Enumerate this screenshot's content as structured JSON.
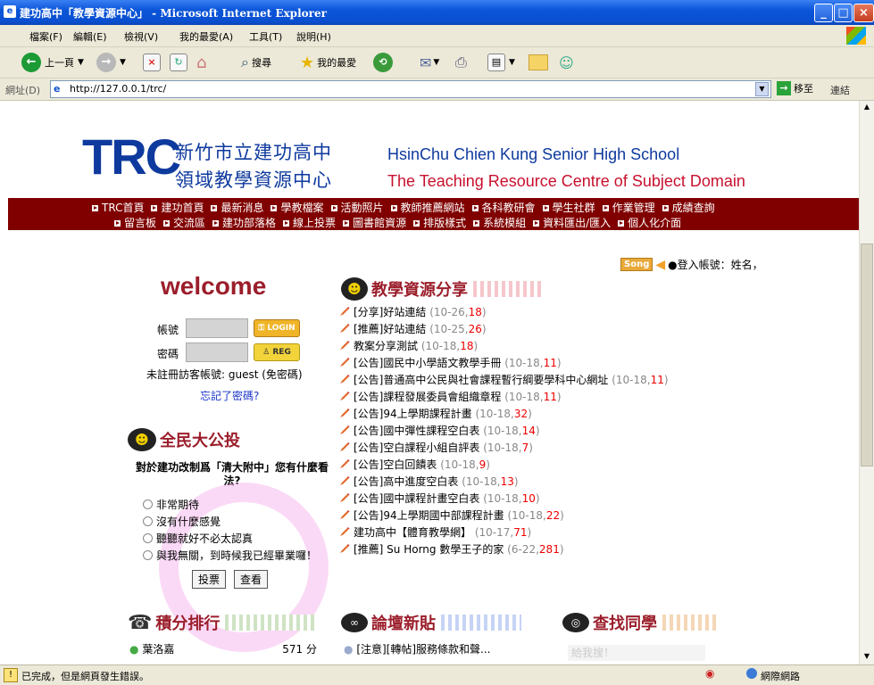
{
  "window": {
    "title": "建功高中「教學資源中心」 - Microsoft Internet Explorer"
  },
  "menubar": [
    "檔案(F)",
    "編輯(E)",
    "檢視(V)",
    "我的最愛(A)",
    "工具(T)",
    "說明(H)"
  ],
  "toolbar": {
    "back": "上一頁",
    "search": "搜尋",
    "favorites": "我的最愛"
  },
  "address": {
    "label": "網址(D)",
    "url": "http://127.0.0.1/trc/",
    "go": "移至",
    "links": "連結"
  },
  "header": {
    "logo": "TRC",
    "zh_line1": "新竹市立建功高中",
    "zh_line2": "領域教學資源中心",
    "en_line1": "HsinChu Chien Kung Senior High School",
    "en_line2": "The Teaching Resource Centre of Subject Domain"
  },
  "nav": {
    "row1": [
      "TRC首頁",
      "建功首頁",
      "最新消息",
      "學教檔案",
      "活動照片",
      "教師推薦網站",
      "各科教研會",
      "學生社群",
      "作業管理",
      "成績查詢"
    ],
    "row2": [
      "留言板",
      "交流區",
      "建功部落格",
      "線上投票",
      "圖書館資源",
      "排版樣式",
      "系統模組",
      "資料匯出/匯入",
      "個人化介面"
    ]
  },
  "userbar": {
    "song": "Song",
    "login_info": "●登入帳號：姓名，"
  },
  "login": {
    "welcome": "welcome",
    "account_label": "帳號",
    "password_label": "密碼",
    "login_btn": "LOGIN",
    "reg_btn": "REG",
    "guest_text": "未註冊訪客帳號: guest (免密碼)",
    "forgot": "忘記了密碼?"
  },
  "poll": {
    "heading": "全民大公投",
    "question": "對於建功改制爲「清大附中」您有什麼看法?",
    "options": [
      "非常期待",
      "沒有什麼感覺",
      "聽聽就好不必太認真",
      "與我無關，到時候我已經畢業囉！"
    ],
    "vote_btn": "投票",
    "view_btn": "查看"
  },
  "resources": {
    "heading": "教學資源分享",
    "items": [
      {
        "title": "[分享]好站連結",
        "date": "10-26",
        "count": "18"
      },
      {
        "title": "[推薦]好站連結",
        "date": "10-25",
        "count": "26"
      },
      {
        "title": "教案分享測試",
        "date": "10-18",
        "count": "18"
      },
      {
        "title": "[公告]國民中小學語文教學手冊",
        "date": "10-18",
        "count": "11"
      },
      {
        "title": "[公告]普通高中公民與社會課程暫行綱要學科中心網址",
        "date": "10-18",
        "count": "11"
      },
      {
        "title": "[公告]課程發展委員會組織章程",
        "date": "10-18",
        "count": "11"
      },
      {
        "title": "[公告]94上學期課程計畫",
        "date": "10-18",
        "count": "32"
      },
      {
        "title": "[公告]國中彈性課程空白表",
        "date": "10-18",
        "count": "14"
      },
      {
        "title": "[公告]空白課程小組自評表",
        "date": "10-18",
        "count": "7"
      },
      {
        "title": "[公告]空白回饋表",
        "date": "10-18",
        "count": "9"
      },
      {
        "title": "[公告]高中進度空白表",
        "date": "10-18",
        "count": "13"
      },
      {
        "title": "[公告]國中課程計畫空白表",
        "date": "10-18",
        "count": "10"
      },
      {
        "title": "[公告]94上學期國中部課程計畫",
        "date": "10-18",
        "count": "22"
      },
      {
        "title": "建功高中【體育教學網】",
        "date": "10-17",
        "count": "71"
      },
      {
        "title": "[推薦] Su Horng 數學王子的家",
        "date": "6-22",
        "count": "281"
      }
    ]
  },
  "ranking": {
    "heading": "積分排行",
    "first_name": "葉洛嘉",
    "first_score": "571 分"
  },
  "forum": {
    "heading": "論壇新貼",
    "first_post": "[注意][轉帖]服務條款和聲..."
  },
  "classmates": {
    "heading": "查找同學",
    "placeholder": "給我搜！"
  },
  "status": {
    "text": "已完成，但是網頁發生錯誤。",
    "zone": "網際網路"
  },
  "colors": {
    "nav_bg": "#800000",
    "logo_blue": "#0e3a9e",
    "section_red": "#9b1e2b"
  }
}
